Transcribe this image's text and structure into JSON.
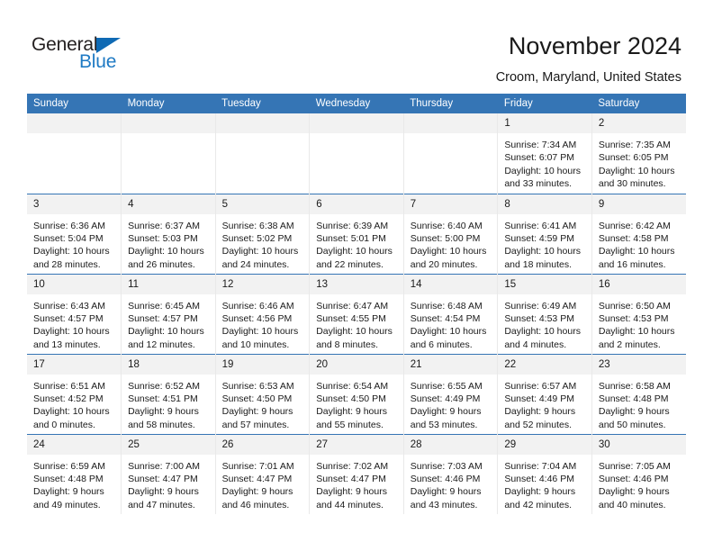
{
  "brand": {
    "name_part1": "General",
    "name_part2": "Blue",
    "triangle_icon": "triangle-icon",
    "color_dark": "#231f20",
    "color_blue": "#1f7ac4"
  },
  "header": {
    "title": "November 2024",
    "subtitle": "Croom, Maryland, United States"
  },
  "theme": {
    "header_blue": "#3575b5",
    "daynum_band": "#f2f2f2",
    "text": "#1a1a1a",
    "cell_border": "#e9e9e9"
  },
  "calendar": {
    "weekday_headers": [
      "Sunday",
      "Monday",
      "Tuesday",
      "Wednesday",
      "Thursday",
      "Friday",
      "Saturday"
    ],
    "weeks": [
      [
        {
          "day": "",
          "empty": true
        },
        {
          "day": "",
          "empty": true
        },
        {
          "day": "",
          "empty": true
        },
        {
          "day": "",
          "empty": true
        },
        {
          "day": "",
          "empty": true
        },
        {
          "day": "1",
          "sunrise": "Sunrise: 7:34 AM",
          "sunset": "Sunset: 6:07 PM",
          "daylight": "Daylight: 10 hours and 33 minutes."
        },
        {
          "day": "2",
          "sunrise": "Sunrise: 7:35 AM",
          "sunset": "Sunset: 6:05 PM",
          "daylight": "Daylight: 10 hours and 30 minutes."
        }
      ],
      [
        {
          "day": "3",
          "sunrise": "Sunrise: 6:36 AM",
          "sunset": "Sunset: 5:04 PM",
          "daylight": "Daylight: 10 hours and 28 minutes."
        },
        {
          "day": "4",
          "sunrise": "Sunrise: 6:37 AM",
          "sunset": "Sunset: 5:03 PM",
          "daylight": "Daylight: 10 hours and 26 minutes."
        },
        {
          "day": "5",
          "sunrise": "Sunrise: 6:38 AM",
          "sunset": "Sunset: 5:02 PM",
          "daylight": "Daylight: 10 hours and 24 minutes."
        },
        {
          "day": "6",
          "sunrise": "Sunrise: 6:39 AM",
          "sunset": "Sunset: 5:01 PM",
          "daylight": "Daylight: 10 hours and 22 minutes."
        },
        {
          "day": "7",
          "sunrise": "Sunrise: 6:40 AM",
          "sunset": "Sunset: 5:00 PM",
          "daylight": "Daylight: 10 hours and 20 minutes."
        },
        {
          "day": "8",
          "sunrise": "Sunrise: 6:41 AM",
          "sunset": "Sunset: 4:59 PM",
          "daylight": "Daylight: 10 hours and 18 minutes."
        },
        {
          "day": "9",
          "sunrise": "Sunrise: 6:42 AM",
          "sunset": "Sunset: 4:58 PM",
          "daylight": "Daylight: 10 hours and 16 minutes."
        }
      ],
      [
        {
          "day": "10",
          "sunrise": "Sunrise: 6:43 AM",
          "sunset": "Sunset: 4:57 PM",
          "daylight": "Daylight: 10 hours and 13 minutes."
        },
        {
          "day": "11",
          "sunrise": "Sunrise: 6:45 AM",
          "sunset": "Sunset: 4:57 PM",
          "daylight": "Daylight: 10 hours and 12 minutes."
        },
        {
          "day": "12",
          "sunrise": "Sunrise: 6:46 AM",
          "sunset": "Sunset: 4:56 PM",
          "daylight": "Daylight: 10 hours and 10 minutes."
        },
        {
          "day": "13",
          "sunrise": "Sunrise: 6:47 AM",
          "sunset": "Sunset: 4:55 PM",
          "daylight": "Daylight: 10 hours and 8 minutes."
        },
        {
          "day": "14",
          "sunrise": "Sunrise: 6:48 AM",
          "sunset": "Sunset: 4:54 PM",
          "daylight": "Daylight: 10 hours and 6 minutes."
        },
        {
          "day": "15",
          "sunrise": "Sunrise: 6:49 AM",
          "sunset": "Sunset: 4:53 PM",
          "daylight": "Daylight: 10 hours and 4 minutes."
        },
        {
          "day": "16",
          "sunrise": "Sunrise: 6:50 AM",
          "sunset": "Sunset: 4:53 PM",
          "daylight": "Daylight: 10 hours and 2 minutes."
        }
      ],
      [
        {
          "day": "17",
          "sunrise": "Sunrise: 6:51 AM",
          "sunset": "Sunset: 4:52 PM",
          "daylight": "Daylight: 10 hours and 0 minutes."
        },
        {
          "day": "18",
          "sunrise": "Sunrise: 6:52 AM",
          "sunset": "Sunset: 4:51 PM",
          "daylight": "Daylight: 9 hours and 58 minutes."
        },
        {
          "day": "19",
          "sunrise": "Sunrise: 6:53 AM",
          "sunset": "Sunset: 4:50 PM",
          "daylight": "Daylight: 9 hours and 57 minutes."
        },
        {
          "day": "20",
          "sunrise": "Sunrise: 6:54 AM",
          "sunset": "Sunset: 4:50 PM",
          "daylight": "Daylight: 9 hours and 55 minutes."
        },
        {
          "day": "21",
          "sunrise": "Sunrise: 6:55 AM",
          "sunset": "Sunset: 4:49 PM",
          "daylight": "Daylight: 9 hours and 53 minutes."
        },
        {
          "day": "22",
          "sunrise": "Sunrise: 6:57 AM",
          "sunset": "Sunset: 4:49 PM",
          "daylight": "Daylight: 9 hours and 52 minutes."
        },
        {
          "day": "23",
          "sunrise": "Sunrise: 6:58 AM",
          "sunset": "Sunset: 4:48 PM",
          "daylight": "Daylight: 9 hours and 50 minutes."
        }
      ],
      [
        {
          "day": "24",
          "sunrise": "Sunrise: 6:59 AM",
          "sunset": "Sunset: 4:48 PM",
          "daylight": "Daylight: 9 hours and 49 minutes."
        },
        {
          "day": "25",
          "sunrise": "Sunrise: 7:00 AM",
          "sunset": "Sunset: 4:47 PM",
          "daylight": "Daylight: 9 hours and 47 minutes."
        },
        {
          "day": "26",
          "sunrise": "Sunrise: 7:01 AM",
          "sunset": "Sunset: 4:47 PM",
          "daylight": "Daylight: 9 hours and 46 minutes."
        },
        {
          "day": "27",
          "sunrise": "Sunrise: 7:02 AM",
          "sunset": "Sunset: 4:47 PM",
          "daylight": "Daylight: 9 hours and 44 minutes."
        },
        {
          "day": "28",
          "sunrise": "Sunrise: 7:03 AM",
          "sunset": "Sunset: 4:46 PM",
          "daylight": "Daylight: 9 hours and 43 minutes."
        },
        {
          "day": "29",
          "sunrise": "Sunrise: 7:04 AM",
          "sunset": "Sunset: 4:46 PM",
          "daylight": "Daylight: 9 hours and 42 minutes."
        },
        {
          "day": "30",
          "sunrise": "Sunrise: 7:05 AM",
          "sunset": "Sunset: 4:46 PM",
          "daylight": "Daylight: 9 hours and 40 minutes."
        }
      ]
    ]
  }
}
